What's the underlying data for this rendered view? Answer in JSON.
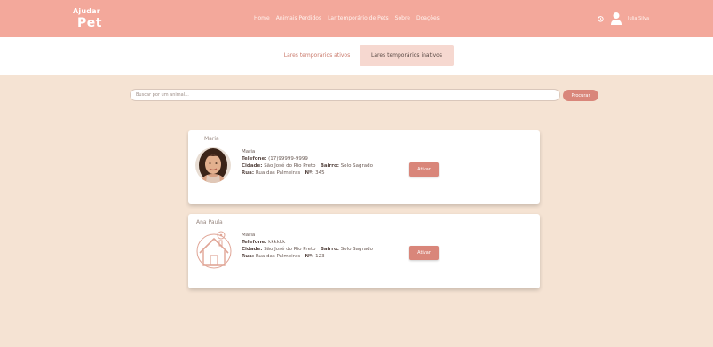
{
  "header": {
    "logo_line1": "Ajudar",
    "logo_line2": "Pet",
    "nav": [
      "Home",
      "Animais Perdidos",
      "Lar temporário de Pets",
      "Sobre",
      "Doações"
    ],
    "user_name": "Julia Silva",
    "icons": [
      "history-icon",
      "user-icon"
    ]
  },
  "tabs": {
    "active_homes": "Lares temporários ativos",
    "inactive_homes": "Lares temporários inativos",
    "selected": "Lares temporários inativos"
  },
  "search": {
    "placeholder": "Buscar por um animal...",
    "button_label": "Procurar"
  },
  "cards": [
    {
      "display_name": "Maria",
      "name": "Maria",
      "phone_label": "Telefone:",
      "phone": "(17)99999-9999",
      "city_label": "Cidade:",
      "city": "São José do Rio Preto",
      "neighborhood_label": "Bairro:",
      "neighborhood": "Solo Sagrado",
      "street_label": "Rua:",
      "street": "Rua das Palmeiras",
      "number_label": "Nº:",
      "number": "345",
      "button_label": "Ativar",
      "image": "person-photo"
    },
    {
      "display_name": "Ana Paula",
      "name": "Maria",
      "phone_label": "Telefone:",
      "phone": "kkkkkk",
      "city_label": "Cidade:",
      "city": "São José do Rio Preto",
      "neighborhood_label": "Bairro:",
      "neighborhood": "Solo Sagrado",
      "street_label": "Rua:",
      "street": "Rua das Palmeiras",
      "number_label": "Nº:",
      "number": "123",
      "button_label": "Ativar",
      "image": "house-icon"
    }
  ],
  "colors": {
    "header_bg": "#f3a89b",
    "page_bg": "#f5e3d3",
    "accent": "#d9867a",
    "active_tab_bg": "#f6d8d0"
  }
}
